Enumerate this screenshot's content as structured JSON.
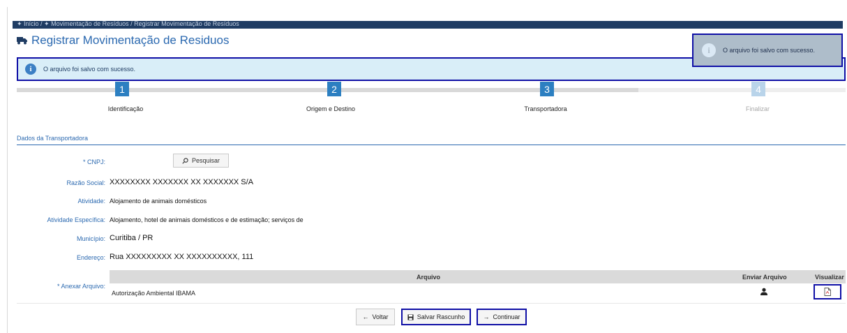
{
  "breadcrumb": "✦ Início / ✦ Movimentação de Resíduos / Registrar Movimentação de Resíduos",
  "page_title": "Registrar Movimentação de Residuos",
  "toast": {
    "message": "O arquivo foi salvo com sucesso.",
    "icon": "info-icon"
  },
  "alert": {
    "message": "O arquivo foi salvo com sucesso.",
    "icon": "info-icon"
  },
  "wizard": {
    "steps": [
      {
        "number": "1",
        "label": "Identificação",
        "state": "done"
      },
      {
        "number": "2",
        "label": "Origem e Destino",
        "state": "done"
      },
      {
        "number": "3",
        "label": "Transportadora",
        "state": "active"
      },
      {
        "number": "4",
        "label": "Finalizar",
        "state": "pending"
      }
    ],
    "colors": {
      "active": "#2c7fc1",
      "pending": "#b9d4ea"
    }
  },
  "section": {
    "title": "Dados da Transportadora"
  },
  "form": {
    "cnpj_label": "* CNPJ:",
    "search_button": "Pesquisar",
    "razao_label": "Razão Social:",
    "razao_value": "XXXXXXXX XXXXXXX XX XXXXXXX S/A",
    "atividade_label": "Atividade:",
    "atividade_value": "Alojamento de animais domésticos",
    "atividade_esp_label": "Atividade Específica:",
    "atividade_esp_value": "Alojamento, hotel de animais domésticos e de estimação; serviços de",
    "municipio_label": "Município:",
    "municipio_value": "Curitiba / PR",
    "endereco_label": "Endereço:",
    "endereco_value": "Rua XXXXXXXXX XX XXXXXXXXXX, 111",
    "anexar_label": "* Anexar Arquivo:"
  },
  "files_table": {
    "headers": {
      "arquivo": "Arquivo",
      "enviar": "Enviar Arquivo",
      "visualizar": "Visualizar"
    },
    "rows": [
      {
        "name": "Autorização Ambiental IBAMA"
      }
    ]
  },
  "actions": {
    "back": "Voltar",
    "save_draft": "Salvar Rascunho",
    "continue": "Continuar"
  },
  "colors": {
    "brand": "#2b69b0",
    "highlight": "#0f0fa6",
    "topbar": "#1f3c63"
  }
}
